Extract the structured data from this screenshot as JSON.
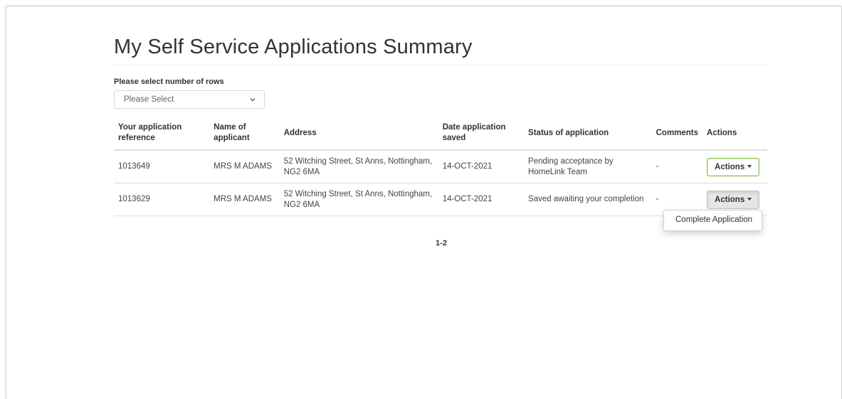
{
  "page": {
    "title": "My Self Service Applications Summary"
  },
  "rows_selector": {
    "label": "Please select number of rows",
    "selected": "Please Select"
  },
  "table": {
    "headers": {
      "reference": "Your application reference",
      "name": "Name of applicant",
      "address": "Address",
      "date": "Date application saved",
      "status": "Status of application",
      "comments": "Comments",
      "actions": "Actions"
    },
    "rows": [
      {
        "reference": "1013649",
        "name": "MRS M ADAMS",
        "address": "52 Witching Street, St Anns, Nottingham, NG2 6MA",
        "date": "14-OCT-2021",
        "status": "Pending acceptance by HomeLink Team",
        "comments": "-",
        "action_label": "Actions"
      },
      {
        "reference": "1013629",
        "name": "MRS M ADAMS",
        "address": "52 Witching Street, St Anns, Nottingham, NG2 6MA",
        "date": "14-OCT-2021",
        "status": "Saved awaiting your completion",
        "comments": "-",
        "action_label": "Actions"
      }
    ]
  },
  "dropdown": {
    "items": [
      "Complete Application"
    ]
  },
  "pagination": {
    "range": "1-2"
  },
  "colors": {
    "focus_border": "#8cc152",
    "open_button_bg": "#e6e6e6",
    "rule": "#dddddd"
  },
  "icons": {
    "select_chevron": "chevron-down-icon",
    "button_caret": "caret-down-icon"
  }
}
